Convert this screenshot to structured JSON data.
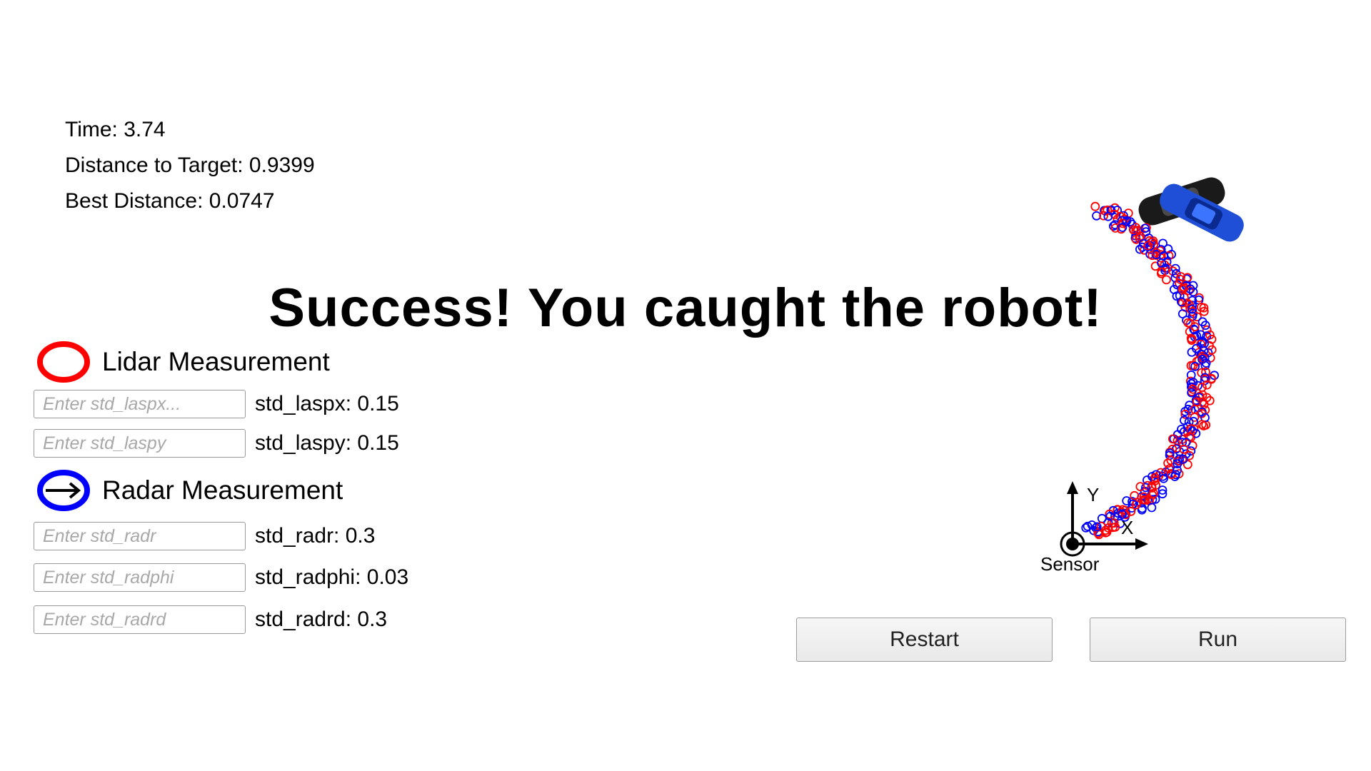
{
  "stats": {
    "time": "Time: 3.74",
    "distance": "Distance to Target: 0.9399",
    "best": "Best Distance: 0.0747"
  },
  "banner": "Success! You caught the robot!",
  "lidar": {
    "label": "Lidar Measurement",
    "color": "#ff0000",
    "params": [
      {
        "placeholder": "Enter std_laspx...",
        "label": "std_laspx: 0.15"
      },
      {
        "placeholder": "Enter std_laspy",
        "label": "std_laspy: 0.15"
      }
    ]
  },
  "radar": {
    "label": "Radar Measurement",
    "color": "#0000ff",
    "params": [
      {
        "placeholder": "Enter std_radr",
        "label": "std_radr: 0.3"
      },
      {
        "placeholder": "Enter std_radphi",
        "label": "std_radphi: 0.03"
      },
      {
        "placeholder": "Enter std_radrd",
        "label": "std_radrd: 0.3"
      }
    ]
  },
  "buttons": {
    "restart": "Restart",
    "run": "Run"
  },
  "axes": {
    "x": "X",
    "y": "Y",
    "sensor": "Sensor"
  }
}
